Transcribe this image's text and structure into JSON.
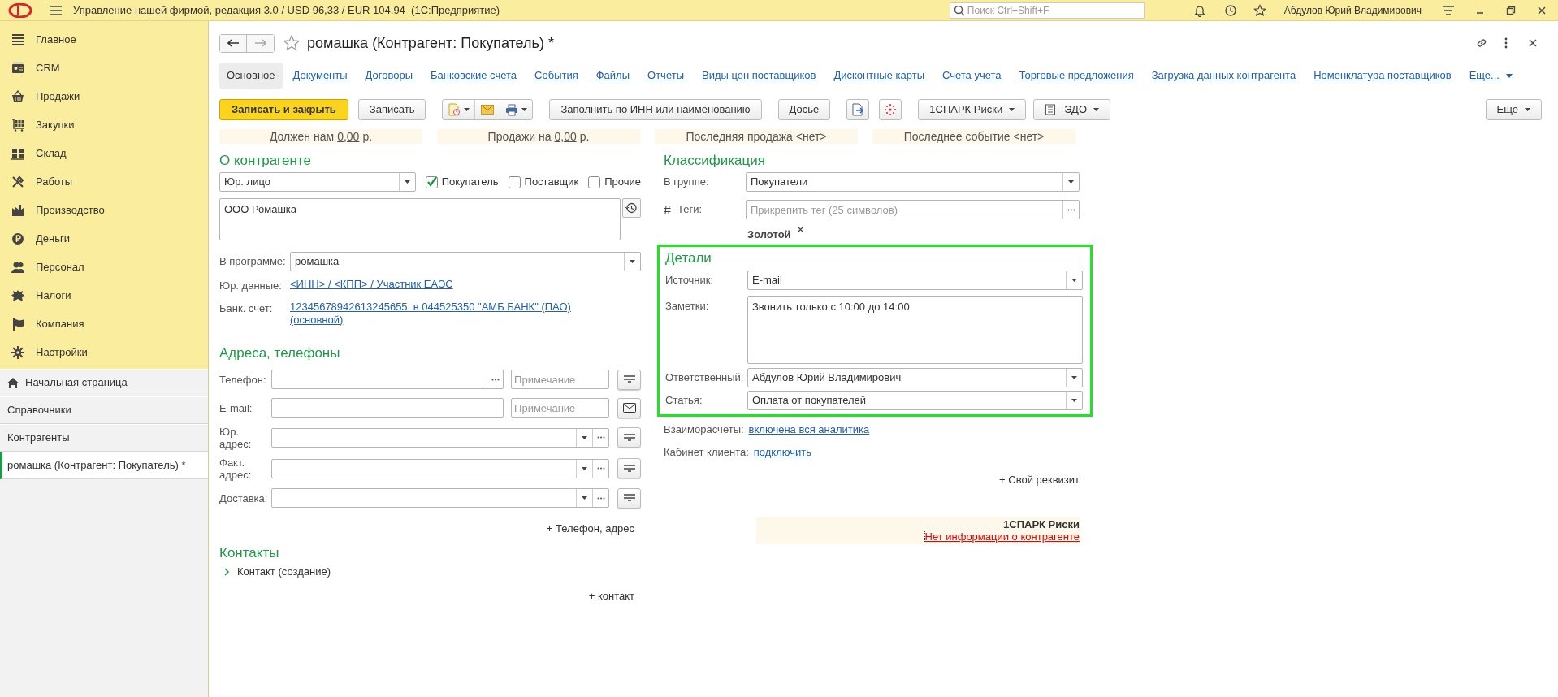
{
  "top_bar": {
    "title": "Управление нашей фирмой, редакция 3.0 / USD 96,33 / EUR 104,94  (1С:Предприятие)",
    "search": {
      "placeholder": "Поиск Ctrl+Shift+F"
    },
    "user": "Абдулов Юрий Владимирович"
  },
  "sidebar": {
    "sections": [
      "Главное",
      "CRM",
      "Продажи",
      "Закупки",
      "Склад",
      "Работы",
      "Производство",
      "Деньги",
      "Персонал",
      "Налоги",
      "Компания",
      "Настройки"
    ],
    "open_windows": [
      {
        "label": "Начальная страница",
        "kind": "home",
        "selected": false
      },
      {
        "label": "Справочники",
        "kind": "plain",
        "selected": false
      },
      {
        "label": "Контрагенты",
        "kind": "plain",
        "selected": false
      },
      {
        "label": "ромашка (Контрагент: Покупатель) *",
        "kind": "plain",
        "selected": true
      }
    ]
  },
  "document": {
    "title": "ромашка (Контрагент: Покупатель) *",
    "tabs": [
      {
        "label": "Основное",
        "selected": true
      },
      {
        "label": "Документы",
        "selected": false
      },
      {
        "label": "Договоры",
        "selected": false
      },
      {
        "label": "Банковские счета",
        "selected": false
      },
      {
        "label": "События",
        "selected": false
      },
      {
        "label": "Файлы",
        "selected": false
      },
      {
        "label": "Отчеты",
        "selected": false
      },
      {
        "label": "Виды цен поставщиков",
        "selected": false
      },
      {
        "label": "Дисконтные карты",
        "selected": false
      },
      {
        "label": "Счета учета",
        "selected": false
      },
      {
        "label": "Торговые предложения",
        "selected": false
      },
      {
        "label": "Загрузка данных контрагента",
        "selected": false
      },
      {
        "label": "Номенклатура поставщиков",
        "selected": false
      },
      {
        "label": "Еще...",
        "selected": false
      }
    ],
    "toolbar": [
      {
        "kind": "primary",
        "label": "Записать и закрыть"
      },
      {
        "kind": "plain",
        "label": "Записать"
      },
      {
        "kind": "icon_group"
      },
      {
        "kind": "plain",
        "label": "Заполнить по ИНН или наименованию"
      },
      {
        "kind": "plain",
        "label": "Досье"
      },
      {
        "kind": "doc_icon"
      },
      {
        "kind": "spark_icon"
      },
      {
        "kind": "menu",
        "label": "1СПАРК Риски"
      },
      {
        "kind": "edo",
        "label": "ЭДО"
      }
    ],
    "more_button": "Еще",
    "summary": [
      {
        "kind": "amount",
        "label": "Должен нам",
        "amount": "0,00",
        "unit": "р."
      },
      {
        "kind": "amount",
        "label": "Продажи на",
        "amount": "0,00",
        "unit": "р."
      },
      {
        "kind": "text",
        "label": "Последняя продажа <нет>"
      },
      {
        "kind": "text",
        "label": "Последнее событие <нет>"
      }
    ],
    "about": {
      "heading": "О контрагенте",
      "type": "Юр. лицо",
      "roles": [
        {
          "label": "Покупатель",
          "checked": true
        },
        {
          "label": "Поставщик",
          "checked": false
        },
        {
          "label": "Прочие",
          "checked": false
        }
      ],
      "full_name": "ООО Ромашка",
      "program_label": "В программе:",
      "program_name": "ромашка",
      "links": [
        {
          "label": "Юр. данные:",
          "lines": [
            "<ИНН> / <КПП> / Участник ЕАЭС"
          ]
        },
        {
          "label": "Банк. счет:",
          "lines": [
            "12345678942613245655  в 044525350 \"АМБ БАНК\" (ПАО)",
            "(основной)"
          ]
        }
      ]
    },
    "addresses": {
      "heading": "Адреса, телефоны",
      "rows": [
        {
          "kind": "phone",
          "label": "Телефон:",
          "note_placeholder": "Примечание"
        },
        {
          "kind": "email",
          "label": "E-mail:",
          "note_placeholder": "Примечание"
        },
        {
          "kind": "address",
          "label": "Юр. адрес:"
        },
        {
          "kind": "address",
          "label": "Факт. адрес:"
        },
        {
          "kind": "address",
          "label": "Доставка:"
        }
      ],
      "add_link": "+ Телефон, адрес"
    },
    "contacts": {
      "heading": "Контакты",
      "items": [
        {
          "label": "Контакт (создание)",
          "expanded": false
        }
      ],
      "add_link": "+ контакт"
    },
    "classification": {
      "heading": "Классификация",
      "group_label": "В группе:",
      "group": "Покупатели",
      "tags_label": "Теги:",
      "tags_placeholder": "Прикрепить тег (25 символов)",
      "tags": [
        "Золотой"
      ]
    },
    "details": {
      "heading": "Детали",
      "fields": [
        {
          "kind": "select",
          "label": "Источник:",
          "value": "E-mail"
        },
        {
          "kind": "memo",
          "label": "Заметки:",
          "value": "Звонить только с 10:00 до 14:00"
        },
        {
          "kind": "select",
          "label": "Ответственный:",
          "value": "Абдулов Юрий Владимирович"
        },
        {
          "kind": "select",
          "label": "Статья:",
          "value": "Оплата от покупателей"
        }
      ]
    },
    "extra_links": [
      {
        "label": "Взаиморасчеты:",
        "link": "включена вся аналитика"
      },
      {
        "label": "Кабинет клиента:",
        "link": "подключить"
      }
    ],
    "add_attribute": "+ Свой реквизит",
    "spark": {
      "title": "1СПАРК Риски",
      "message": "Нет информации о контрагенте"
    }
  }
}
